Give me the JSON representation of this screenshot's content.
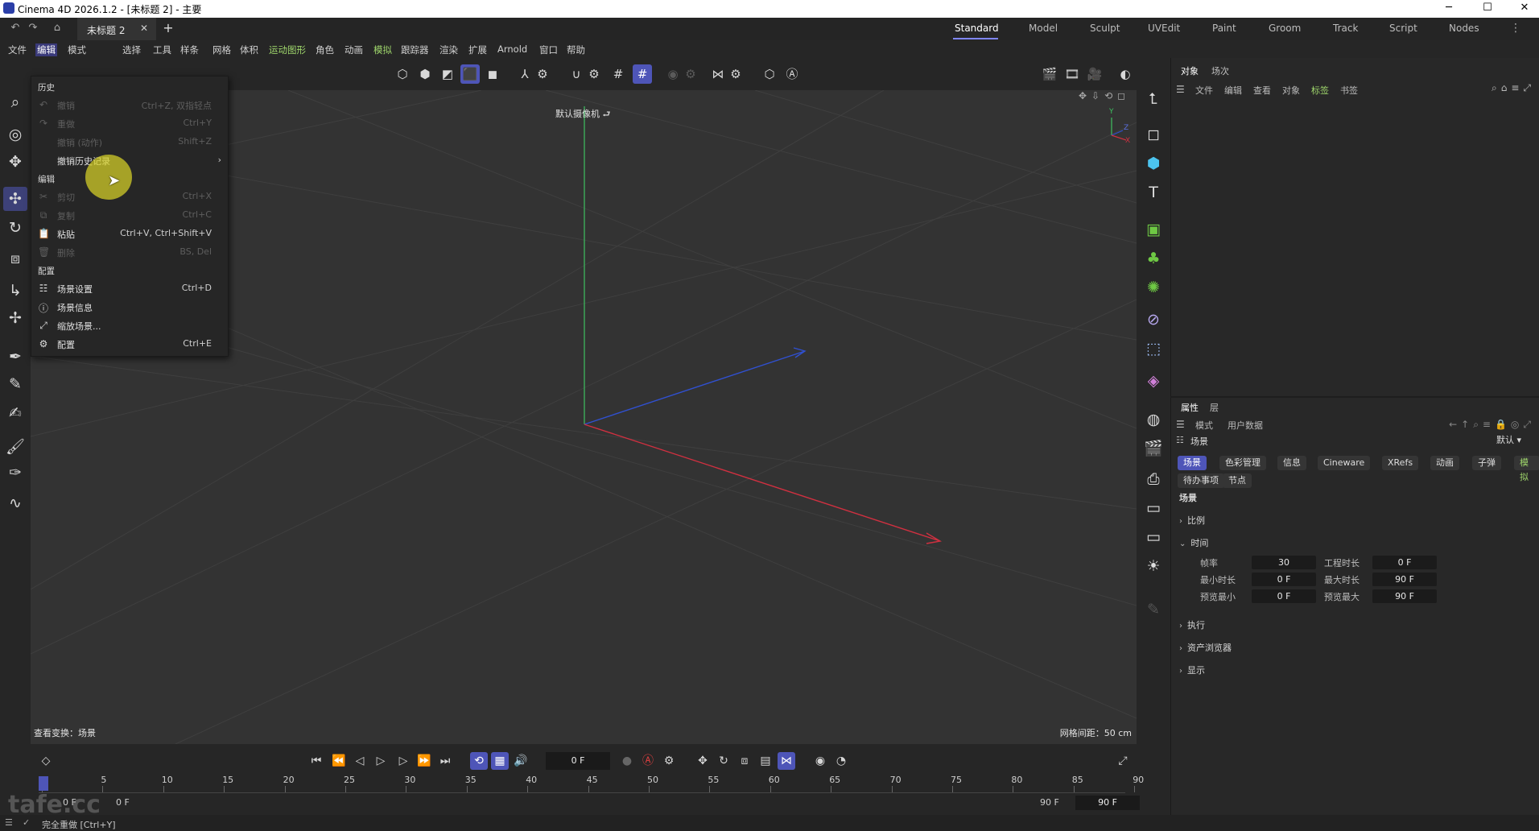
{
  "window": {
    "title": "Cinema 4D 2026.1.2 - [未标题 2] - 主要",
    "controls": {
      "minimize": "─",
      "maximize": "☐",
      "close": "✕"
    }
  },
  "tabbar": {
    "document_tab": "未标题 2",
    "add_tab": "+",
    "layouts": [
      "Standard",
      "Model",
      "Sculpt",
      "UVEdit",
      "Paint",
      "Groom",
      "Track",
      "Script",
      "Nodes"
    ],
    "active_layout": "Standard"
  },
  "menubar": {
    "items": [
      "文件",
      "编辑",
      "模式",
      "选择",
      "工具",
      "样条",
      "网格",
      "体积",
      "运动图形",
      "角色",
      "动画",
      "模拟",
      "跟踪器",
      "渲染",
      "扩展",
      "Arnold",
      "窗口",
      "帮助"
    ],
    "active": "编辑",
    "highlighted": [
      "运动图形",
      "模拟"
    ]
  },
  "dropdown": {
    "history_header": "历史",
    "history_items": [
      {
        "label": "撤销",
        "shortcut": "Ctrl+Z, 双指轻点",
        "icon": "↶",
        "disabled": true
      },
      {
        "label": "重做",
        "shortcut": "Ctrl+Y",
        "icon": "↷",
        "disabled": true
      },
      {
        "label": "撤销 (动作)",
        "shortcut": "Shift+Z",
        "icon": "",
        "disabled": true
      },
      {
        "label": "撤销历史记录",
        "shortcut": "",
        "icon": "",
        "disabled": false,
        "submenu": "›"
      }
    ],
    "edit_header": "编辑",
    "edit_items": [
      {
        "label": "剪切",
        "shortcut": "Ctrl+X",
        "icon": "✂",
        "disabled": true
      },
      {
        "label": "复制",
        "shortcut": "Ctrl+C",
        "icon": "⧉",
        "disabled": true
      },
      {
        "label": "粘贴",
        "shortcut": "Ctrl+V, Ctrl+Shift+V",
        "icon": "📋",
        "disabled": false
      },
      {
        "label": "删除",
        "shortcut": "BS, Del",
        "icon": "🗑",
        "disabled": true
      }
    ],
    "config_header": "配置",
    "config_items": [
      {
        "label": "场景设置",
        "shortcut": "Ctrl+D",
        "icon": "☷"
      },
      {
        "label": "场景信息",
        "shortcut": "",
        "icon": "ⓘ"
      },
      {
        "label": "缩放场景...",
        "shortcut": "",
        "icon": "⤢"
      },
      {
        "label": "配置",
        "shortcut": "Ctrl+E",
        "icon": "⚙"
      }
    ]
  },
  "viewport": {
    "camera_label": "默认摄像机 ⮐",
    "bottom_left": "查看变换：场景",
    "bottom_right": "网格间距：50 cm",
    "axis_labels": {
      "y": "Y",
      "z": "Z",
      "x": "X"
    }
  },
  "object_manager": {
    "tabs": [
      "对象",
      "场次"
    ],
    "menus": [
      "文件",
      "编辑",
      "查看",
      "对象",
      "标签",
      "书签"
    ],
    "highlight_menu": "标签"
  },
  "attributes": {
    "tabs": [
      "属性",
      "层"
    ],
    "menus": [
      "模式",
      "用户数据"
    ],
    "context": "场景",
    "preset": "默认",
    "chips_row1": [
      "场景",
      "色彩管理",
      "信息",
      "Cineware",
      "XRefs",
      "动画",
      "子弹",
      "模拟"
    ],
    "chips_row2": [
      "待办事项",
      "节点"
    ],
    "section_title": "场景",
    "groups_collapsed_top": [
      "比例"
    ],
    "time_group": "时间",
    "fields": [
      {
        "label": "帧率",
        "value": "30"
      },
      {
        "label": "工程时长",
        "value": "0 F"
      },
      {
        "label": "最小时长",
        "value": "0 F"
      },
      {
        "label": "最大时长",
        "value": "90 F"
      },
      {
        "label": "预览最小",
        "value": "0 F"
      },
      {
        "label": "预览最大",
        "value": "90 F"
      }
    ],
    "groups_collapsed_bottom": [
      "执行",
      "资产浏览器",
      "显示"
    ]
  },
  "timeline": {
    "current_frame": "0 F",
    "ticks": [
      "0",
      "5",
      "10",
      "15",
      "20",
      "25",
      "30",
      "35",
      "40",
      "45",
      "50",
      "55",
      "60",
      "65",
      "70",
      "75",
      "80",
      "85",
      "90"
    ],
    "range_start_a": "0 F",
    "range_start_b": "0 F",
    "range_end_a": "90 F",
    "range_end_b": "90 F"
  },
  "status": {
    "text": "完全重做 [Ctrl+Y]"
  },
  "watermark": "tafe.cc",
  "colors": {
    "accent": "#4e55b8",
    "menu_green": "#9ed56b",
    "axis_x": "#d03040",
    "axis_y": "#3ec060",
    "axis_z": "#3050d0"
  }
}
